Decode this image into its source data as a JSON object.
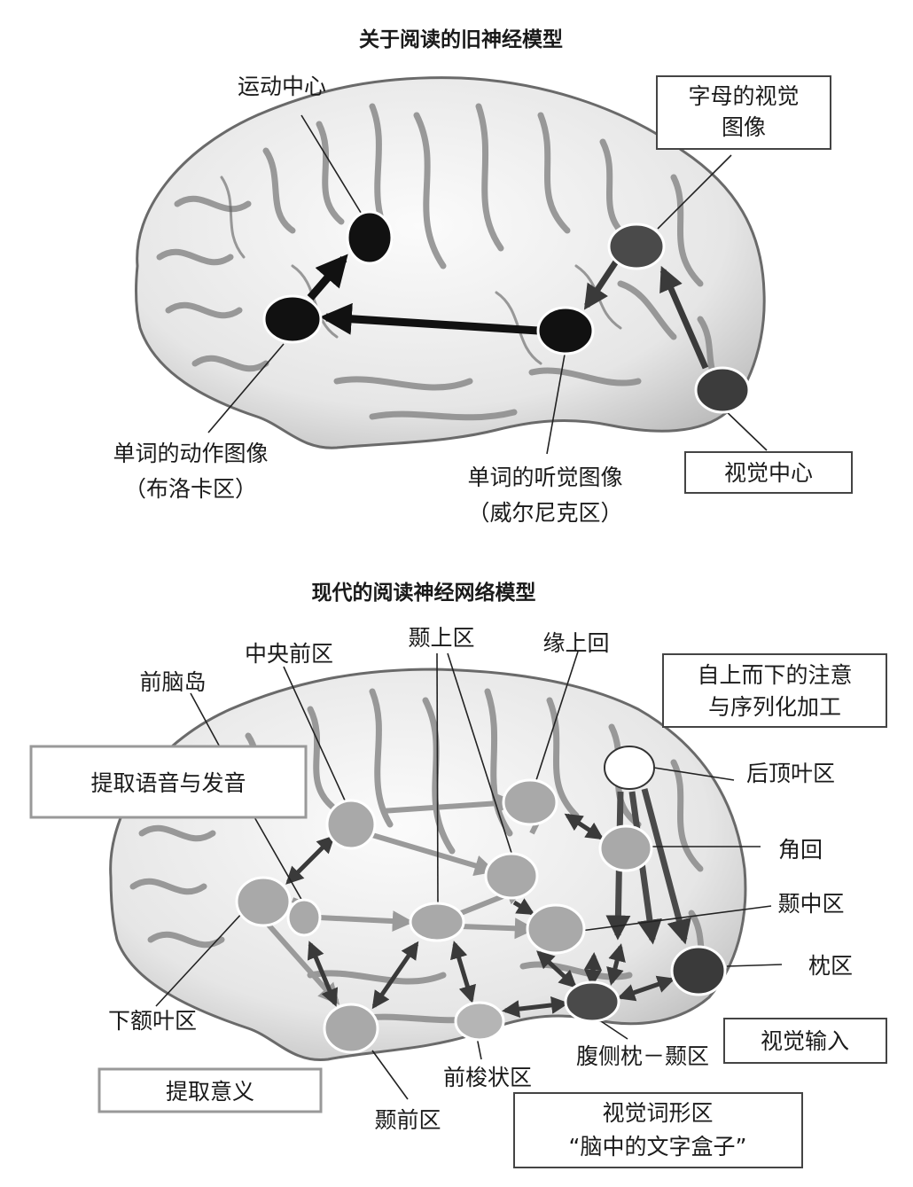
{
  "old_model": {
    "title": "关于阅读的旧神经模型",
    "labels": {
      "motor": "运动中心",
      "letters_line1": "字母的视觉",
      "letters_line2": "图像",
      "broca_line1": "单词的动作图像",
      "broca_line2": "（布洛卡区）",
      "wernicke_line1": "单词的听觉图像",
      "wernicke_line2": "（威尔尼克区）",
      "visual": "视觉中心"
    }
  },
  "new_model": {
    "title": "现代的阅读神经网络模型",
    "labels": {
      "insula": "前脑岛",
      "precentral": "中央前区",
      "superior_temporal": "颞上区",
      "supramarginal": "缘上回",
      "topdown_line1": "自上而下的注意",
      "topdown_line2": "与序列化加工",
      "phonology": "提取语音与发音",
      "posterior_parietal": "后顶叶区",
      "angular": "角回",
      "middle_temporal": "颞中区",
      "occipital": "枕区",
      "inferior_frontal": "下额叶区",
      "visual_input": "视觉输入",
      "occipitotemporal": "腹侧枕－颞区",
      "meaning": "提取意义",
      "fusiform": "前梭状区",
      "temporal_pole": "颞前区",
      "vwfa_line1": "视觉词形区",
      "vwfa_line2": "“脑中的文字盒子”"
    }
  },
  "colors": {
    "brain_fill": "#f2f2f2",
    "brain_groove": "#8a8a8a",
    "old_node": "#111111",
    "new_node": "#a9a9a9",
    "new_node_dark": "#4a4a4a",
    "arrow_dark": "#3a3a3a",
    "arrow_light": "#9a9a9a"
  }
}
